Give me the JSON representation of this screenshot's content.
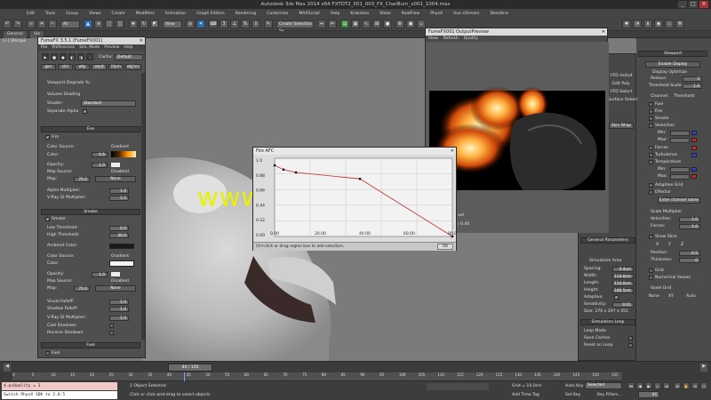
{
  "window": {
    "title": "Autodesk 3ds Max 2014 x64    FXTDT2_001_003_FX_CharBurn_v001_1004.max",
    "min": "_",
    "max": "□",
    "close": "✕"
  },
  "menu": [
    "Edit",
    "Tools",
    "Group",
    "Views",
    "Create",
    "Modifiers",
    "Animation",
    "Graph Editors",
    "Rendering",
    "Customize",
    "MAXScript",
    "Help",
    "Krakatoa",
    "Stoke",
    "RealFlow",
    "PhysX",
    "Vue xStream",
    "Deadline"
  ],
  "toolbar": {
    "selection_filter": "All",
    "view_combo": "View",
    "named_selection": "Create Selection Se"
  },
  "ribbon": {
    "tab1": "General",
    "tab2": "Vie"
  },
  "viewport": {
    "label": "[+] [Perspe",
    "watermark": "www.cgtsj.com"
  },
  "fumefx_panel": {
    "title": "FumeFX 3.5.1 (FumeFX001)",
    "menu": [
      "File",
      "Preferences",
      "Sim. Mode",
      "Preview",
      "Help"
    ],
    "cache_label": "Cache:",
    "cache_value": "Default",
    "tabs": [
      "gen",
      "sim",
      "wtp",
      "rend",
      "illum",
      "obj/src"
    ],
    "viewport_degrade_label": "Viewport Degrade %:",
    "volume_shading_label": "Volume Shading",
    "shader_label": "Shader:",
    "shader_value": "Standard",
    "separate_alpha_label": "Separate Alpha",
    "separate_alpha_check": "✔",
    "fire_rollout": "Fire",
    "fire_check_label": "Fire",
    "fire": {
      "color_source_label": "Color Source:",
      "color_source_value": "Gradient",
      "color_label": "Color:",
      "color_value": "0.6",
      "opacity_label": "Opacity:",
      "opacity_value": "1.0",
      "map_source_label": "Map Source:",
      "map_source_value": "Disabled",
      "map_label": "Map:",
      "map_value": "70.0",
      "map_button": "None",
      "alpha_multiplier_label": "Alpha Multiplier:",
      "alpha_multiplier_value": "1.0",
      "vray_gi_label": "V-Ray GI Multiplier:",
      "vray_gi_value": "1.0"
    },
    "smoke_rollout": "Smoke",
    "smoke_check_label": "Smoke",
    "smoke": {
      "low_threshold_label": "Low Threshold:",
      "low_threshold_value": "0.0",
      "high_threshold_label": "High Threshold:",
      "high_threshold_value": "30.0",
      "ambient_color_label": "Ambient Color:",
      "color_source_label": "Color Source:",
      "color_source_value": "Gradient",
      "color_label": "Color:",
      "opacity_label": "Opacity:",
      "opacity_value": "1.0",
      "map_source_label": "Map Source:",
      "map_source_value": "Disabled",
      "map_label": "Map:",
      "map_value": "70.0",
      "map_button": "None",
      "visual_falloff_label": "Visual Falloff:",
      "visual_falloff_value": "1.0",
      "shadow_falloff_label": "Shadow Falloff:",
      "shadow_falloff_value": "1.0",
      "vray_gi_label": "V-Ray GI Multiplier:",
      "vray_gi_value": "1.0",
      "cast_shadows_label": "Cast Shadows:",
      "receive_shadows_label": "Receive Shadows:"
    },
    "fuel_rollout": "Fuel",
    "fuel_check_label": "Fuel"
  },
  "output_preview": {
    "title": "FumeFX001 OutputPreview",
    "menu": [
      "View",
      "Refresh",
      "Quality"
    ],
    "bottom_left": "uel",
    "bottom_right": "| 0.40"
  },
  "fire_afc": {
    "title": "Fire AFC",
    "y_ticks": [
      "1.0",
      "0.88",
      "0.66",
      "0.44",
      "0.22",
      "0.00"
    ],
    "x_ticks": [
      "0.00",
      "20.00",
      "40.00",
      "60.00",
      "80.00"
    ],
    "status": "Ctrl-click or drag region box to add selection.",
    "ok_label": "OK"
  },
  "chart_data": {
    "type": "line",
    "title": "Fire AFC",
    "xlabel": "",
    "ylabel": "",
    "xlim": [
      0,
      100
    ],
    "ylim": [
      0,
      1.1
    ],
    "x": [
      0,
      5,
      12,
      48,
      100
    ],
    "y": [
      1.0,
      0.94,
      0.9,
      0.81,
      0.0
    ],
    "grid": true
  },
  "command_panel": {
    "ffd_label": "FFD 4x4x4",
    "edit_poly": "Edit Poly",
    "ffd_select": "FFD Select",
    "surface_select": "Surface Select",
    "skin_wrap": "Skin Wrap",
    "general_params": "General Parameters",
    "simulation_area": "Simulation Area",
    "spacing_label": "Spacing:",
    "spacing_value": "0.4cm",
    "width_label": "Width:",
    "width_value": "114.0cm",
    "length_label": "Length:",
    "length_value": "114.0cm",
    "height_label": "Height:",
    "height_value": "180.5cm",
    "adaptive_label": "Adaptive:",
    "sensitivity_label": "Sensitivity:",
    "sensitivity_value": "0.01",
    "size_label": "Size: 270 x 297 x 451",
    "simulation_loop": "Simulation Loop",
    "loop_mode": "Loop Mode",
    "save_caches": "Save Caches",
    "reset_on_loop": "Reset on Loop"
  },
  "viewport_panel": {
    "title": "Viewport",
    "enable_display": "Enable Display",
    "display_optimize": "Display Optimize",
    "reduce_label": "Reduce:",
    "reduce_value": "3",
    "threshold_scale_label": "Threshold Scale:",
    "threshold_scale_value": "1.0",
    "channel_label": "Channel:",
    "threshold_label": "Threshold:",
    "channels": [
      "Fuel",
      "Fire",
      "Smoke",
      "Velocities",
      "Forces",
      "Turbulence",
      "Temperature"
    ],
    "min_label": "Min:",
    "max_label": "Max:",
    "adaptive_grid": "Adaptive Grid",
    "effector": "Effector",
    "enter_channel": "Enter channel name",
    "scale_multiplier": "Scale Multiplier",
    "velocities_label": "Velocities:",
    "velocities_value": "1.0",
    "forces_label": "Forces:",
    "forces_value": "1.0",
    "show_slice": "Show Slice",
    "axis_options": [
      "X",
      "Y",
      "Z"
    ],
    "position_label": "Position:",
    "position_value": "0.5",
    "thickness_label": "Thickness:",
    "thickness_value": "0",
    "grid": "Grid",
    "numerical_values": "Numerical Values",
    "voxel_grid": "Voxel Grid",
    "voxel_options": [
      "None",
      "XY",
      "Auto"
    ]
  },
  "timeline": {
    "frame_counter": "44 / 155",
    "ticks": [
      "0",
      "5",
      "10",
      "15",
      "20",
      "25",
      "30",
      "35",
      "40",
      "45",
      "50",
      "55",
      "60",
      "65",
      "70",
      "75",
      "80",
      "85",
      "90",
      "95",
      "100",
      "105",
      "110",
      "115",
      "120",
      "125",
      "130",
      "135",
      "140",
      "145",
      "150",
      "155"
    ]
  },
  "status": {
    "script1": "$.pvQuality = 3",
    "script2": "Switch PhysX SDK to 2.8.5",
    "selected": "1 Object Selected",
    "prompt": "Click or click-and-drag to select objects",
    "grid": "Grid = 10.0cm",
    "add_time_tag": "Add Time Tag",
    "auto_key": "Auto Key",
    "set_key": "Set Key",
    "selected_combo": "Selected",
    "key_filters": "Key Filters...",
    "frame_value": "44"
  }
}
